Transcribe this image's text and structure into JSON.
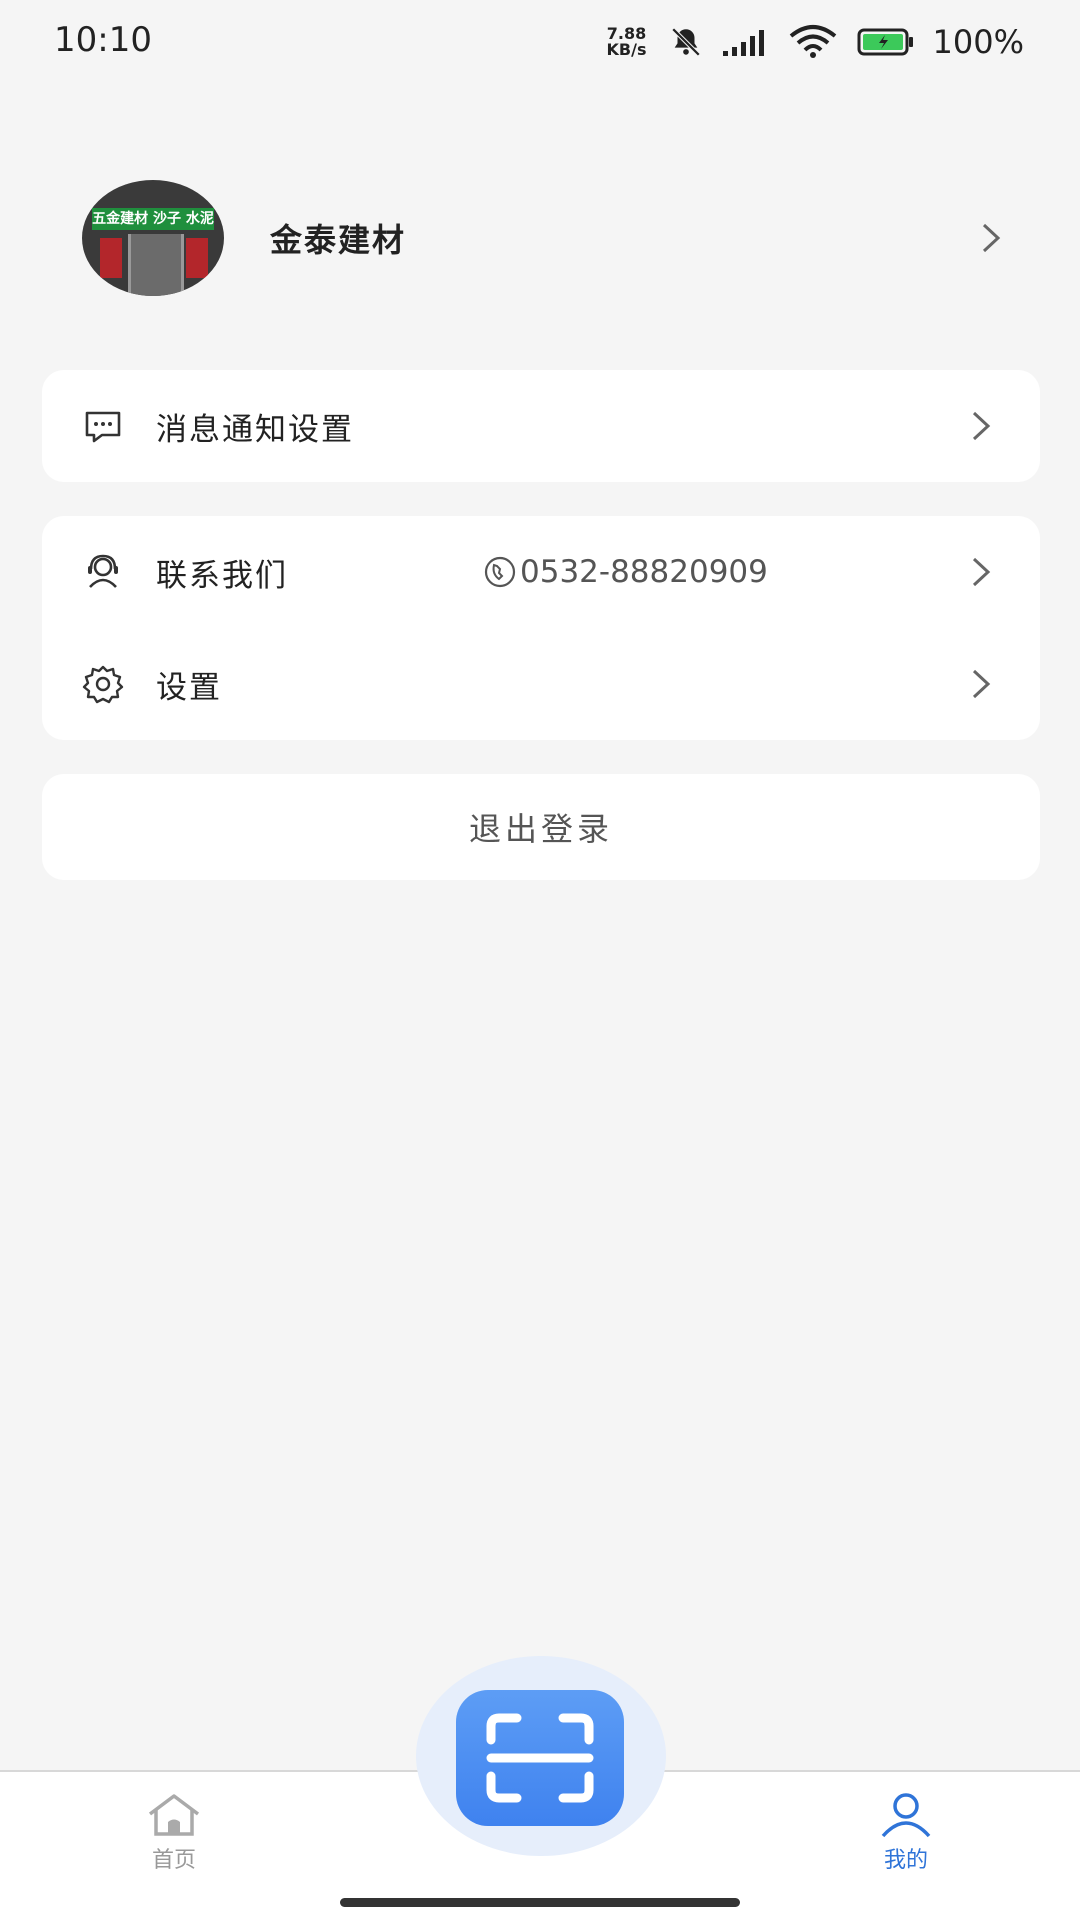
{
  "status_bar": {
    "time": "10:10",
    "speed_value": "7.88",
    "speed_unit": "KB/s",
    "battery": "100%"
  },
  "profile": {
    "avatar_sign_text": "五金建材 沙子 水泥",
    "name": "金泰建材"
  },
  "menu": {
    "notification_settings": "消息通知设置",
    "contact_us": "联系我们",
    "contact_phone": "0532-88820909",
    "settings": "设置",
    "logout": "退出登录"
  },
  "bottom_nav": {
    "home": "首页",
    "mine": "我的",
    "active": "mine"
  },
  "colors": {
    "accent": "#2f74d8",
    "scan_button": "#4a8ff2",
    "background": "#f5f5f5"
  }
}
